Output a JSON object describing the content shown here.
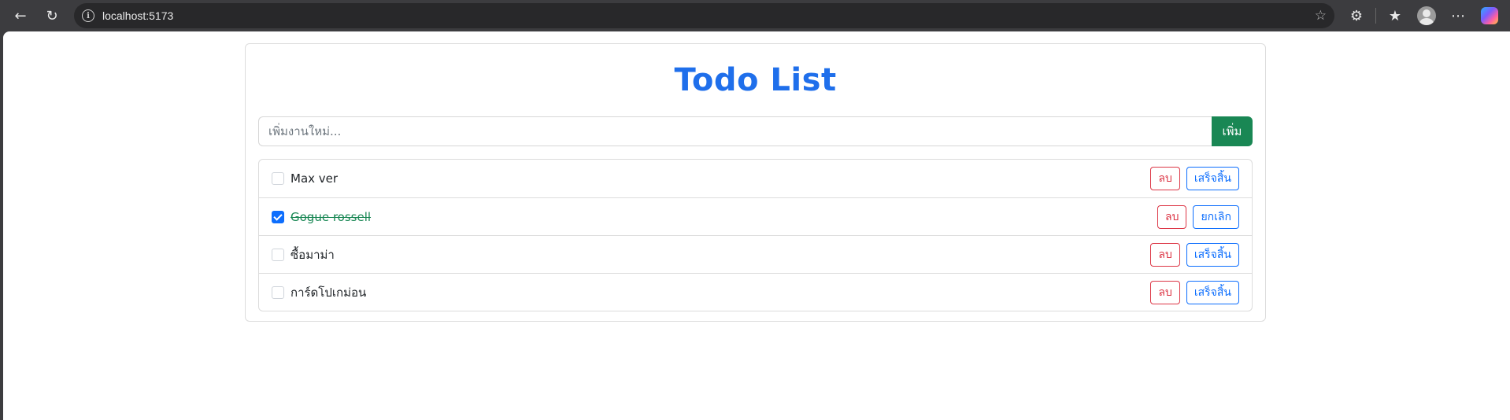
{
  "browser": {
    "url": "localhost:5173"
  },
  "app": {
    "title": "Todo List",
    "input": {
      "placeholder": "เพิ่มงานใหม่...",
      "value": ""
    },
    "add_label": "เพิ่ม",
    "todos": [
      {
        "text": "Max ver",
        "done": false,
        "delete_label": "ลบ",
        "toggle_label": "เสร็จสิ้น"
      },
      {
        "text": "Gogue rossell",
        "done": true,
        "delete_label": "ลบ",
        "toggle_label": "ยกเลิก"
      },
      {
        "text": "ซื้อมาม่า",
        "done": false,
        "delete_label": "ลบ",
        "toggle_label": "เสร็จสิ้น"
      },
      {
        "text": "การ์ดโปเกม่อน",
        "done": false,
        "delete_label": "ลบ",
        "toggle_label": "เสร็จสิ้น"
      }
    ]
  },
  "colors": {
    "title": "#1f6feb",
    "add_button": "#198754",
    "delete": "#dc3545",
    "toggle": "#0d6efd",
    "done_text": "#198754"
  }
}
